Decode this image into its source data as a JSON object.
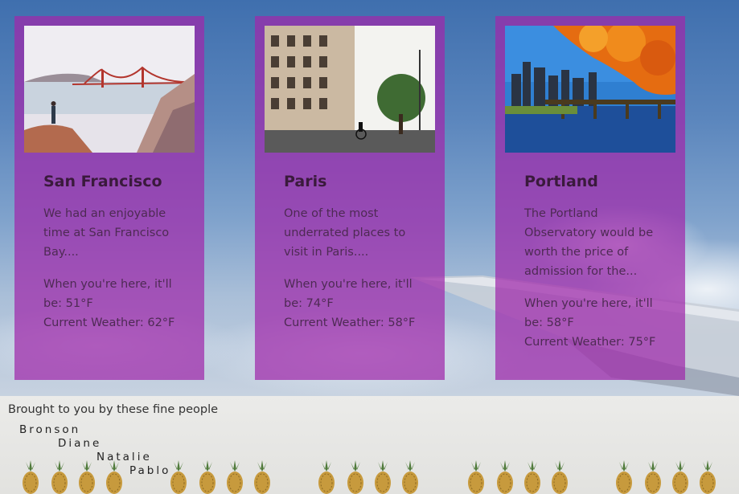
{
  "cards": [
    {
      "title": "San Francisco",
      "description": "We had an enjoyable time at San Francisco Bay....",
      "forecast": "When you're here, it'll be: 51°F",
      "current": "Current Weather: 62°F",
      "image": "golden-gate-bridge-photo"
    },
    {
      "title": "Paris",
      "description": "One of the most underrated places to visit in Paris....",
      "forecast": "When you're here, it'll be: 74°F",
      "current": "Current Weather: 58°F",
      "image": "paris-street-photo"
    },
    {
      "title": "Portland",
      "description": "The Portland Observatory would be worth the price of admission for the...",
      "forecast": "When you're here, it'll be: 58°F",
      "current": "Current Weather: 75°F",
      "image": "portland-skyline-photo"
    }
  ],
  "footer": {
    "credit": "Brought to you by these fine people",
    "people": [
      "Bronson",
      "Diane",
      "Natalie",
      "Pablo"
    ]
  },
  "colors": {
    "card_bg": "#a028aa",
    "sky_top": "#3f6fae",
    "footer_bg": "#ebebe9"
  }
}
